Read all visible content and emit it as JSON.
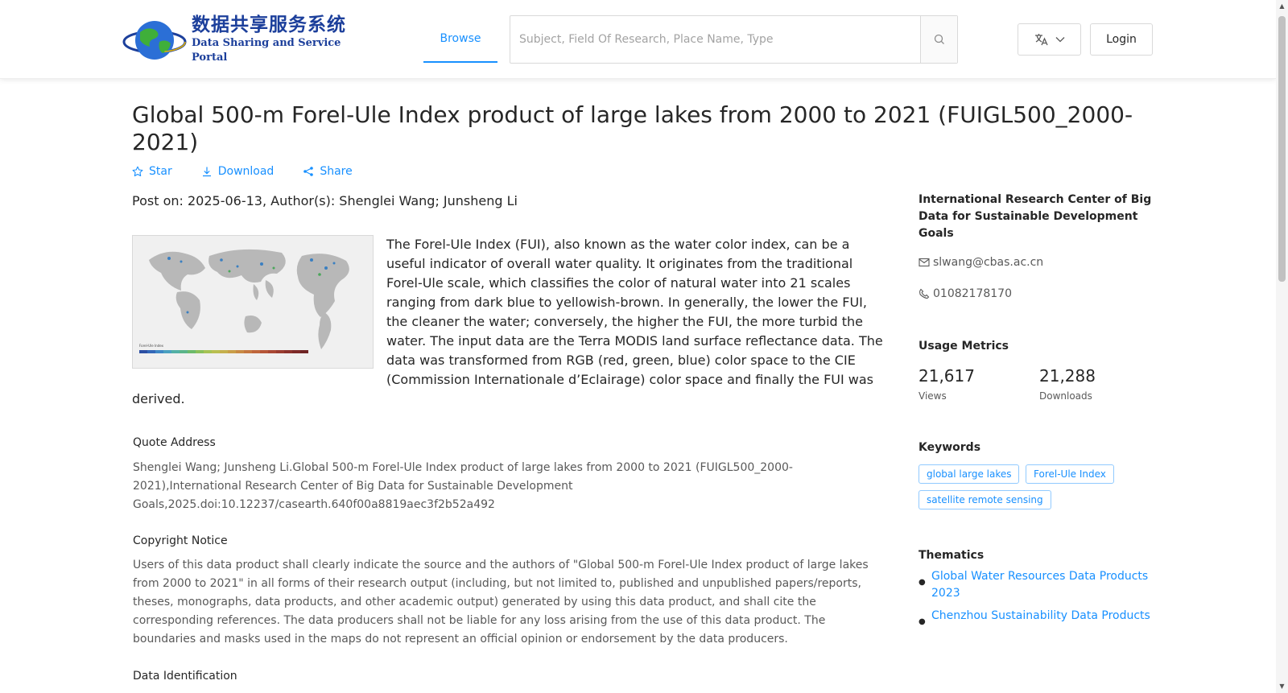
{
  "header": {
    "logo_cn": "数据共享服务系统",
    "logo_en": "Data Sharing and Service Portal",
    "nav_browse": "Browse",
    "search_placeholder": "Subject, Field Of Research, Place Name, Type",
    "login": "Login"
  },
  "dataset": {
    "title": "Global 500-m Forel-Ule Index product of large lakes from 2000 to 2021 (FUIGL500_2000-2021)",
    "actions": {
      "star": "Star",
      "download": "Download",
      "share": "Share"
    },
    "post_info": "Post on: 2025-06-13, Author(s): Shenglei Wang; Junsheng Li",
    "description": "The Forel-Ule Index (FUI), also known as the water color index, can be a useful indicator of overall water quality. It originates from the traditional Forel-Ule scale, which classifies the color of natural water into 21 scales ranging from dark blue to yellowish-brown. In generally, the lower the FUI, the cleaner the water; conversely, the higher the FUI, the more turbid the water. The input data are the Terra MODIS land surface reflectance data. The data was transformed from RGB (red, green, blue) color space to the CIE (Commission Internationale d’Eclairage) color space and finally the FUI was derived."
  },
  "sections": {
    "quote_head": "Quote Address",
    "quote_body": "Shenglei Wang; Junsheng Li.Global 500-m Forel-Ule Index product of large lakes from 2000 to 2021 (FUIGL500_2000-2021),International Research Center of Big Data for Sustainable Development Goals,2025.doi:10.12237/casearth.640f00a8819aec3f2b52a492",
    "copyright_head": "Copyright Notice",
    "copyright_body": "Users of this data product shall clearly indicate the source and the authors of \"Global 500-m Forel-Ule Index product of large lakes from 2000 to 2021\" in all forms of their research output (including, but not limited to, published and unpublished papers/reports, theses, monographs, data products, and other academic output) generated by using this data product, and shall cite the corresponding references. The data producers shall not be liable for any loss arising from the use of this data product. The boundaries and masks used in the maps do not represent an official opinion or endorsement by the data producers.",
    "data_id_head": "Data Identification"
  },
  "sidebar": {
    "org": "International Research Center of Big Data for Sustainable Development Goals",
    "email": "slwang@cbas.ac.cn",
    "phone": "01082178170",
    "usage_head": "Usage Metrics",
    "views_value": "21,617",
    "views_label": "Views",
    "downloads_value": "21,288",
    "downloads_label": "Downloads",
    "keywords_head": "Keywords",
    "keywords": [
      "global large lakes",
      "Forel-Ule Index",
      "satellite remote sensing"
    ],
    "thematics_head": "Thematics",
    "thematics": [
      "Global Water Resources Data Products 2023",
      "Chenzhou Sustainability Data Products"
    ]
  },
  "colors": {
    "accent": "#1890ff",
    "logo_blue": "#1c3f9b"
  }
}
